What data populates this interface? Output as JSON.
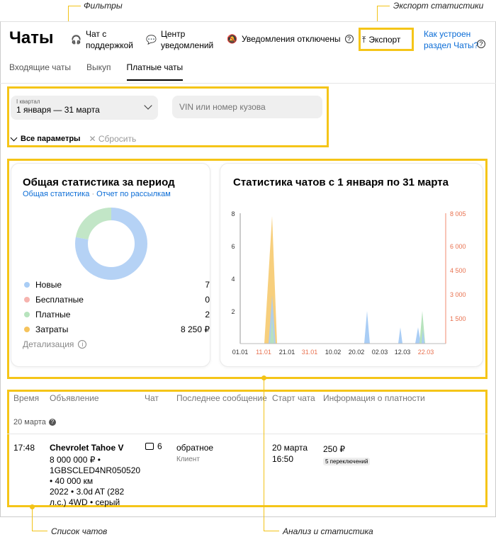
{
  "annotations": {
    "filters": "Фильтры",
    "export_stats": "Экспорт статистики",
    "chat_list": "Список чатов",
    "analysis": "Анализ и статистика"
  },
  "header": {
    "title": "Чаты",
    "support": "Чат с поддержкой",
    "notify_center": "Центр уведомлений",
    "notify_off": "Уведомления отключены",
    "export": "Экспорт",
    "help": "Как устроен раздел Чаты?"
  },
  "tabs": [
    "Входящие чаты",
    "Выкуп",
    "Платные чаты"
  ],
  "filters": {
    "period_label": "I квартал",
    "period_value": "1 января — 31 марта",
    "vin_placeholder": "VIN или номер кузова",
    "all_params": "Все параметры",
    "reset": "Сбросить"
  },
  "summary": {
    "title": "Общая статистика за период",
    "link1": "Общая статистика",
    "sep": "·",
    "link2": "Отчет по рассылкам",
    "legend": [
      {
        "label": "Новые",
        "value": "7",
        "color": "#a9cdf5"
      },
      {
        "label": "Бесплатные",
        "value": "0",
        "color": "#f6b3ae"
      },
      {
        "label": "Платные",
        "value": "2",
        "color": "#b7e3bd"
      },
      {
        "label": "Затраты",
        "value": "8 250 ₽",
        "color": "#f5c35c"
      }
    ],
    "details": "Детализация"
  },
  "chart_data": {
    "type": "area",
    "title": "Статистика чатов с 1 января по 31 марта",
    "x": [
      "01.01",
      "11.01",
      "21.01",
      "31.01",
      "10.02",
      "20.02",
      "02.03",
      "12.03",
      "22.03"
    ],
    "x_red": [
      "11.01",
      "31.01",
      "22.03"
    ],
    "left_ticks": [
      8,
      6,
      4,
      2
    ],
    "right_ticks": [
      "8 005",
      "6 000",
      "4 500",
      "3 000",
      "1 500"
    ],
    "donut": {
      "new": 7,
      "paid": 2
    }
  },
  "table": {
    "headers": [
      "Время",
      "Объявление",
      "Чат",
      "Последнее сообщение",
      "Старт чата",
      "Информация о платности"
    ],
    "group_date": "20 марта",
    "row": {
      "time": "17:48",
      "car": "Chevrolet Tahoe V",
      "details": [
        "8 000 000 ₽ •",
        "1GBSCLED4NR050520",
        "• 40 000 км",
        "2022 • 3.0d AT (282",
        "л.с.) 4WD • серый"
      ],
      "chat_count": "6",
      "last_msg": "обратное",
      "sender": "Клиент",
      "start_date": "20 марта",
      "start_time": "16:50",
      "price": "250 ₽",
      "switches": "5 переключений"
    }
  }
}
